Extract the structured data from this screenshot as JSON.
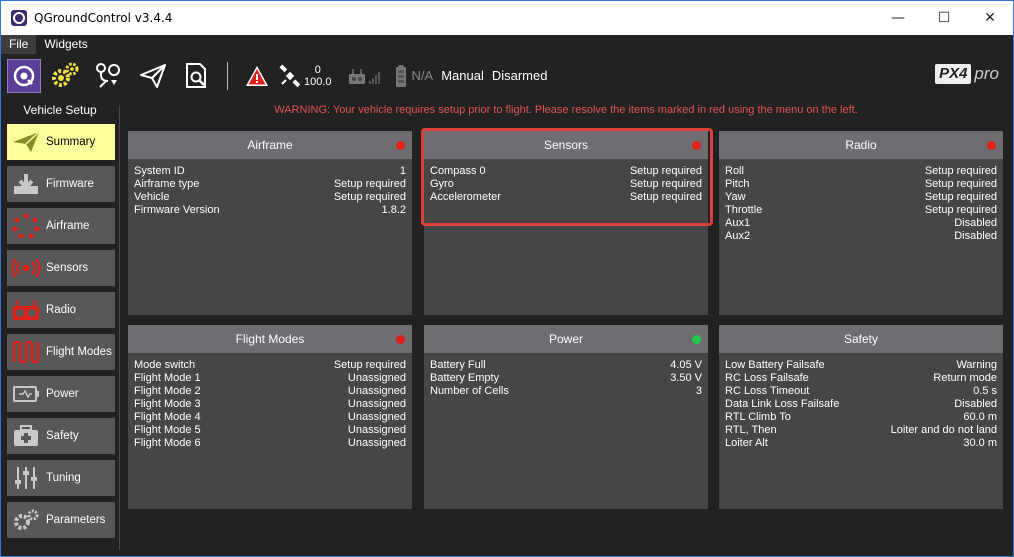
{
  "window": {
    "title": "QGroundControl v3.4.4",
    "controls": {
      "minimize": "—",
      "maximize": "☐",
      "close": "✕"
    }
  },
  "menu": {
    "items": [
      "File",
      "Widgets"
    ]
  },
  "toolbar": {
    "gps_count": "0",
    "gps_hdop": "100.0",
    "battery": "N/A",
    "flight_mode": "Manual",
    "arm_state": "Disarmed",
    "brand": "PX4",
    "brand_suffix": "pro"
  },
  "sidebar": {
    "title": "Vehicle Setup",
    "items": [
      {
        "label": "Summary",
        "icon": "paper-plane-icon"
      },
      {
        "label": "Firmware",
        "icon": "download-icon"
      },
      {
        "label": "Airframe",
        "icon": "airframe-icon"
      },
      {
        "label": "Sensors",
        "icon": "sensors-icon"
      },
      {
        "label": "Radio",
        "icon": "radio-icon"
      },
      {
        "label": "Flight Modes",
        "icon": "flight-modes-icon"
      },
      {
        "label": "Power",
        "icon": "battery-icon"
      },
      {
        "label": "Safety",
        "icon": "first-aid-icon"
      },
      {
        "label": "Tuning",
        "icon": "sliders-icon"
      },
      {
        "label": "Parameters",
        "icon": "gears-icon"
      }
    ]
  },
  "warning": "WARNING: Your vehicle requires setup prior to flight. Please resolve the items marked in red using the menu on the left.",
  "colors": {
    "status_red": "#e0201b",
    "status_green": "#1fc84a",
    "accent_yellow": "#fdfd9b"
  },
  "cards": [
    {
      "title": "Airframe",
      "status": "red",
      "rows": [
        [
          "System ID",
          "1"
        ],
        [
          "Airframe type",
          "Setup required"
        ],
        [
          "Vehicle",
          "Setup required"
        ],
        [
          "Firmware Version",
          "1.8.2"
        ]
      ]
    },
    {
      "title": "Sensors",
      "status": "red",
      "rows": [
        [
          "Compass 0",
          "Setup required"
        ],
        [
          "Gyro",
          "Setup required"
        ],
        [
          "Accelerometer",
          "Setup required"
        ]
      ]
    },
    {
      "title": "Radio",
      "status": "red",
      "rows": [
        [
          "Roll",
          "Setup required"
        ],
        [
          "Pitch",
          "Setup required"
        ],
        [
          "Yaw",
          "Setup required"
        ],
        [
          "Throttle",
          "Setup required"
        ],
        [
          "Aux1",
          "Disabled"
        ],
        [
          "Aux2",
          "Disabled"
        ]
      ]
    },
    {
      "title": "Flight Modes",
      "status": "red",
      "rows": [
        [
          "Mode switch",
          "Setup required"
        ],
        [
          "Flight Mode 1",
          "Unassigned"
        ],
        [
          "Flight Mode 2",
          "Unassigned"
        ],
        [
          "Flight Mode 3",
          "Unassigned"
        ],
        [
          "Flight Mode 4",
          "Unassigned"
        ],
        [
          "Flight Mode 5",
          "Unassigned"
        ],
        [
          "Flight Mode 6",
          "Unassigned"
        ]
      ]
    },
    {
      "title": "Power",
      "status": "green",
      "rows": [
        [
          "Battery Full",
          "4.05 V"
        ],
        [
          "Battery Empty",
          "3.50 V"
        ],
        [
          "Number of Cells",
          "3"
        ]
      ]
    },
    {
      "title": "Safety",
      "status": "none",
      "rows": [
        [
          "Low Battery Failsafe",
          "Warning"
        ],
        [
          "RC Loss Failsafe",
          "Return mode"
        ],
        [
          "RC Loss Timeout",
          "0.5 s"
        ],
        [
          "Data Link Loss Failsafe",
          "Disabled"
        ],
        [
          "RTL Climb To",
          "60.0 m"
        ],
        [
          "RTL, Then",
          "Loiter and do not land"
        ],
        [
          "Loiter Alt",
          "30.0 m"
        ]
      ]
    }
  ]
}
